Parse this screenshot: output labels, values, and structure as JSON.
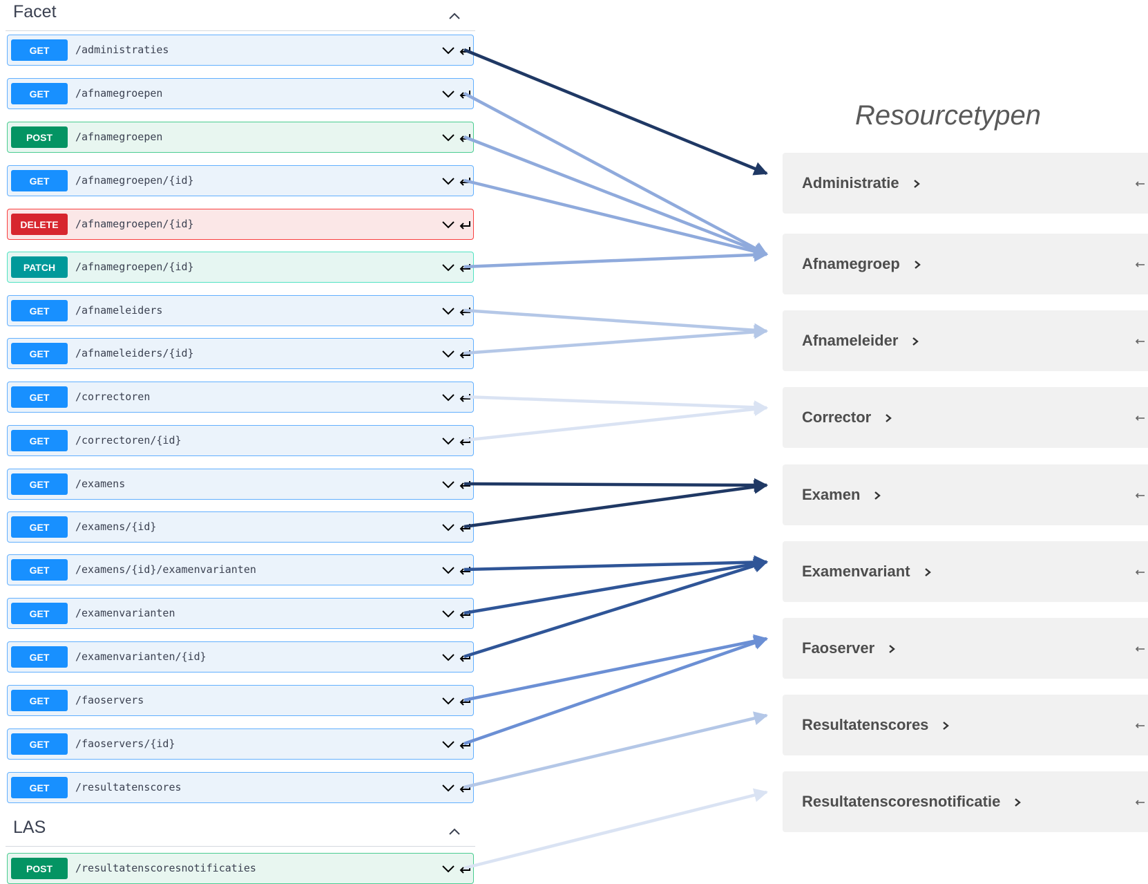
{
  "sections": [
    {
      "title": "Facet"
    },
    {
      "title": "LAS"
    }
  ],
  "operations": [
    {
      "method": "GET",
      "path": "/administraties",
      "target": 0
    },
    {
      "method": "GET",
      "path": "/afnamegroepen",
      "target": 1
    },
    {
      "method": "POST",
      "path": "/afnamegroepen",
      "target": 1
    },
    {
      "method": "GET",
      "path": "/afnamegroepen/{id}",
      "target": 1
    },
    {
      "method": "DELETE",
      "path": "/afnamegroepen/{id}",
      "target": null
    },
    {
      "method": "PATCH",
      "path": "/afnamegroepen/{id}",
      "target": 1
    },
    {
      "method": "GET",
      "path": "/afnameleiders",
      "target": 2
    },
    {
      "method": "GET",
      "path": "/afnameleiders/{id}",
      "target": 2
    },
    {
      "method": "GET",
      "path": "/correctoren",
      "target": 3
    },
    {
      "method": "GET",
      "path": "/correctoren/{id}",
      "target": 3
    },
    {
      "method": "GET",
      "path": "/examens",
      "target": 4
    },
    {
      "method": "GET",
      "path": "/examens/{id}",
      "target": 4
    },
    {
      "method": "GET",
      "path": "/examens/{id}/examenvarianten",
      "target": 5
    },
    {
      "method": "GET",
      "path": "/examenvarianten",
      "target": 5
    },
    {
      "method": "GET",
      "path": "/examenvarianten/{id}",
      "target": 5
    },
    {
      "method": "GET",
      "path": "/faoservers",
      "target": 6
    },
    {
      "method": "GET",
      "path": "/faoservers/{id}",
      "target": 6
    },
    {
      "method": "GET",
      "path": "/resultatenscores",
      "target": 7
    },
    {
      "method": "POST",
      "path": "/resultatenscoresnotificaties",
      "target": 8
    }
  ],
  "resourcetypes_heading": "Resourcetypen",
  "resourcetypes": [
    {
      "label": "Administratie",
      "color": "#1f3864"
    },
    {
      "label": "Afnamegroep",
      "color": "#8faadc"
    },
    {
      "label": "Afnameleider",
      "color": "#b4c7e7"
    },
    {
      "label": "Corrector",
      "color": "#dae3f3"
    },
    {
      "label": "Examen",
      "color": "#1f3864"
    },
    {
      "label": "Examenvariant",
      "color": "#2f5597"
    },
    {
      "label": "Faoserver",
      "color": "#6b8fd4"
    },
    {
      "label": "Resultatenscores",
      "color": "#b4c7e7"
    },
    {
      "label": "Resultatenscoresnotificatie",
      "color": "#dae3f3"
    }
  ],
  "icons": {
    "expand": "chevron-down-icon",
    "collapse": "chevron-up-icon",
    "return": "return-arrow-icon",
    "link": "chevron-right-icon"
  },
  "colors": {
    "get": "#1890ff",
    "post": "#049463",
    "delete": "#d7262e",
    "patch": "#00999a"
  }
}
